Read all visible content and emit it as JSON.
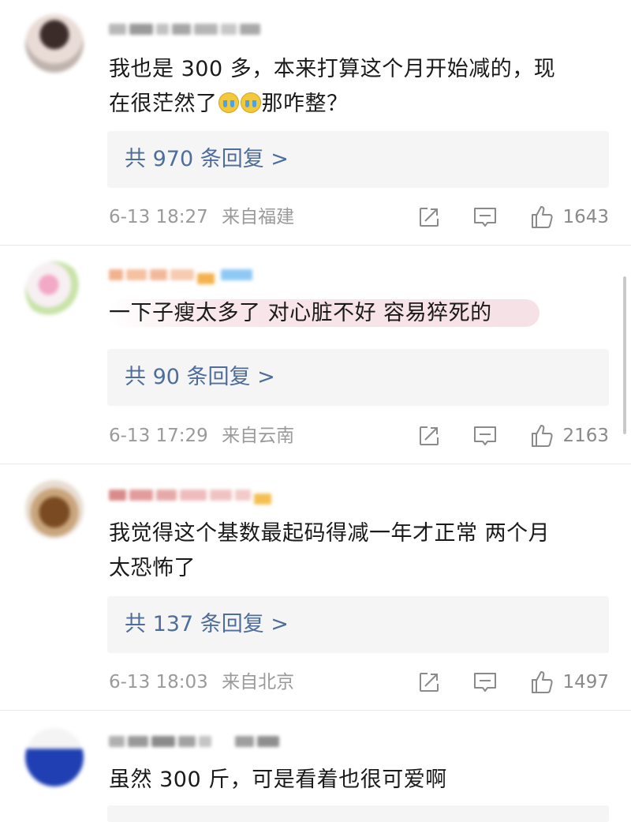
{
  "colors": {
    "link": "#4e6d9a",
    "meta": "#9a9a9a",
    "reply_bg": "#f5f5f5",
    "highlight": "#f6e1e6"
  },
  "icons": {
    "forward": "share-box-icon",
    "comment": "comment-bubble-icon",
    "like": "thumbs-up-icon",
    "emoji": "loudly-crying-face-emoji"
  },
  "comments": [
    {
      "text_line1": "我也是 300 多，本来打算这个月开始减的，现",
      "text_line2_prefix": "在很茫然了",
      "text_line2_suffix": "那咋整？",
      "replies": "共 970 条回复 >",
      "time": "6-13 18:27",
      "location": "来自福建",
      "likes": "1643"
    },
    {
      "text": "一下子瘦太多了  对心脏不好  容易猝死的",
      "replies": "共 90 条回复 >",
      "time": "6-13 17:29",
      "location": "来自云南",
      "likes": "2163"
    },
    {
      "text_line1": "我觉得这个基数最起码得减一年才正常 两个月",
      "text_line2": "太恐怖了",
      "replies": "共 137 条回复 >",
      "time": "6-13 18:03",
      "location": "来自北京",
      "likes": "1497"
    },
    {
      "text": "虽然 300 斤，可是看着也很可爱啊"
    }
  ]
}
